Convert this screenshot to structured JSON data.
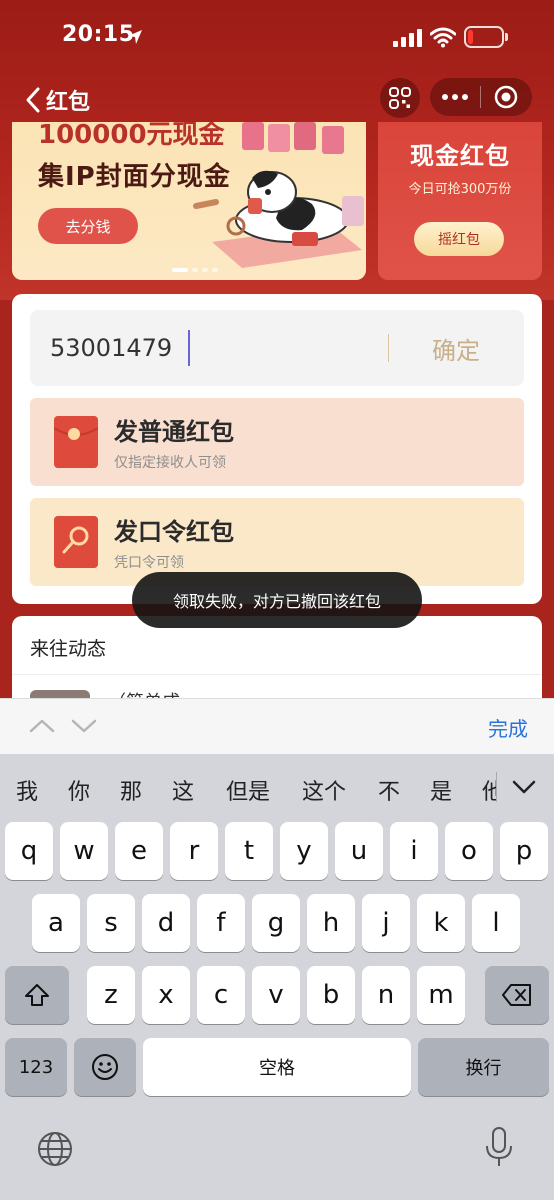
{
  "status_bar": {
    "time": "20:15",
    "battery_level": 0.15
  },
  "nav": {
    "back_label": "红包"
  },
  "banner_left": {
    "headline": "100000元现金",
    "title": "集IP封面分现金",
    "button": "去分钱"
  },
  "banner_right": {
    "title": "现金红包",
    "subtitle": "今日可抢300万份",
    "button": "摇红包"
  },
  "input": {
    "value": "53001479",
    "confirm": "确定"
  },
  "options": [
    {
      "title": "发普通红包",
      "subtitle": "仅指定接收人可领"
    },
    {
      "title": "发口令红包",
      "subtitle": "凭口令可领"
    }
  ],
  "toast": "领取失败，对方已撤回该红包",
  "activity": {
    "title": "来往动态",
    "entry_name": "（简单成"
  },
  "accessory": {
    "done": "完成"
  },
  "keyboard": {
    "candidates": [
      "我",
      "你",
      "那",
      "这",
      "但是",
      "这个",
      "不",
      "是",
      "他"
    ],
    "row1": [
      "q",
      "w",
      "e",
      "r",
      "t",
      "y",
      "u",
      "i",
      "o",
      "p"
    ],
    "row2": [
      "a",
      "s",
      "d",
      "f",
      "g",
      "h",
      "j",
      "k",
      "l"
    ],
    "row3": [
      "z",
      "x",
      "c",
      "v",
      "b",
      "n",
      "m"
    ],
    "numbers_key": "123",
    "space": "空格",
    "return": "换行"
  }
}
